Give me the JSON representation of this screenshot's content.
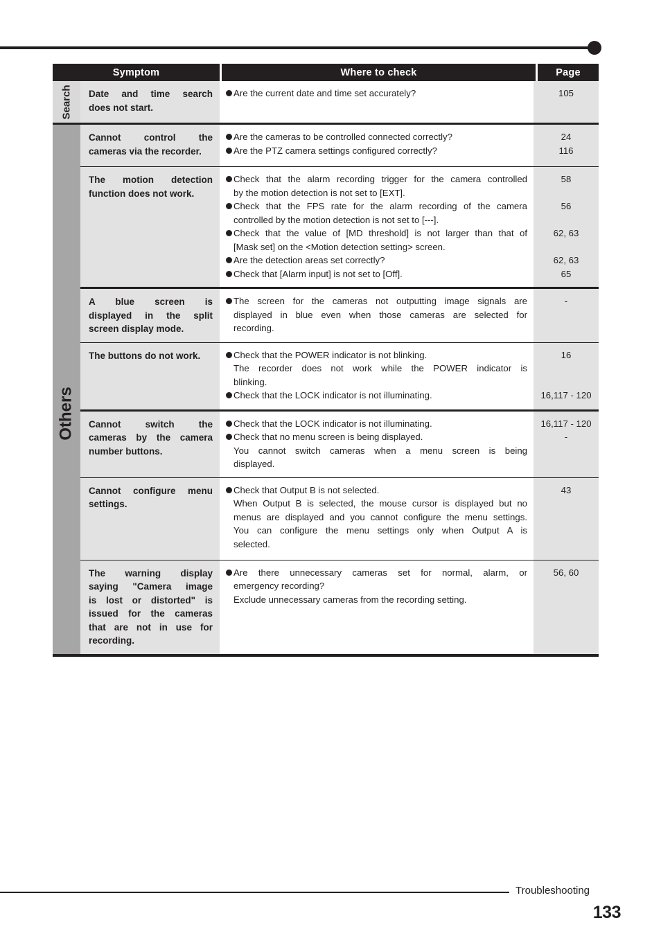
{
  "document": {
    "footer_section": "Troubleshooting",
    "page_number": "133"
  },
  "table": {
    "headers": {
      "symptom": "Symptom",
      "where_to_check": "Where to check",
      "page": "Page"
    },
    "categories": {
      "search": "Search",
      "others": "Others"
    },
    "rows": [
      {
        "symptom_lines": [
          "Date and time search",
          "does not start."
        ],
        "checks": [
          {
            "bullet": true,
            "lines": [
              "Are the current date and time set accurately?"
            ],
            "page": "105"
          }
        ]
      },
      {
        "symptom_lines": [
          "Cannot control the",
          "cameras via the recorder."
        ],
        "checks": [
          {
            "bullet": true,
            "lines": [
              "Are the cameras to be controlled connected correctly?"
            ],
            "page": "24"
          },
          {
            "bullet": true,
            "lines": [
              "Are the PTZ camera settings configured correctly?"
            ],
            "page": "116"
          }
        ]
      },
      {
        "symptom_lines": [
          "The motion detection",
          "function does not work."
        ],
        "checks": [
          {
            "bullet": true,
            "lines": [
              "Check that the alarm recording trigger for the camera controlled",
              "by the motion detection is not set to [EXT]."
            ],
            "page": "58"
          },
          {
            "bullet": true,
            "lines": [
              "Check that the FPS rate for the alarm recording of the camera",
              "controlled by the motion detection is not set to [---]."
            ],
            "page": "56"
          },
          {
            "bullet": true,
            "lines": [
              "Check that the value of [MD threshold] is not larger than that of",
              "[Mask set] on the <Motion detection setting> screen."
            ],
            "page": "62, 63"
          },
          {
            "bullet": true,
            "lines": [
              "Are the detection areas set correctly?"
            ],
            "page": "62, 63"
          },
          {
            "bullet": true,
            "lines": [
              "Check that [Alarm input] is not set to [Off]."
            ],
            "page": "65"
          }
        ]
      },
      {
        "symptom_lines": [
          "A blue screen is",
          "displayed in the split",
          "screen display mode."
        ],
        "checks": [
          {
            "bullet": true,
            "lines": [
              "The screen for the cameras not outputting image signals are",
              "displayed in blue even when those cameras are selected for",
              "recording."
            ],
            "page": "-"
          }
        ]
      },
      {
        "symptom_lines": [
          "The buttons do not work."
        ],
        "checks": [
          {
            "bullet": true,
            "lines": [
              "Check that the POWER indicator is not blinking."
            ],
            "page": "16"
          },
          {
            "bullet": false,
            "lines": [
              "The recorder does not work while the POWER indicator is",
              "blinking."
            ],
            "page": ""
          },
          {
            "bullet": true,
            "lines": [
              "Check that the LOCK indicator is not illuminating."
            ],
            "page": "16,117 - 120"
          }
        ]
      },
      {
        "symptom_lines": [
          "Cannot switch the",
          "cameras by the camera",
          "number buttons."
        ],
        "checks": [
          {
            "bullet": true,
            "lines": [
              "Check that the LOCK indicator is not illuminating."
            ],
            "page": "16,117 - 120"
          },
          {
            "bullet": true,
            "lines": [
              "Check that no menu screen is being displayed."
            ],
            "page": "-"
          },
          {
            "bullet": false,
            "lines": [
              "You cannot switch cameras when a menu screen is being",
              "displayed."
            ],
            "page": ""
          }
        ]
      },
      {
        "symptom_lines": [
          "Cannot configure menu",
          "settings."
        ],
        "checks": [
          {
            "bullet": true,
            "lines": [
              "Check that Output B is not selected."
            ],
            "page": "43"
          },
          {
            "bullet": false,
            "lines": [
              "When Output B is selected, the mouse cursor is displayed but no",
              "menus are displayed and you cannot configure the menu settings.",
              "You can configure the menu settings only when Output A is",
              "selected."
            ],
            "page": ""
          }
        ]
      },
      {
        "symptom_lines": [
          "The warning display",
          "saying \"Camera image",
          "is lost or distorted\" is",
          "issued for the cameras",
          "that are not in use for",
          "recording."
        ],
        "checks": [
          {
            "bullet": true,
            "lines": [
              "Are there unnecessary cameras set for normal, alarm, or",
              "emergency recording?"
            ],
            "page": "56, 60"
          },
          {
            "bullet": false,
            "lines": [
              "Exclude unnecessary cameras from the recording setting."
            ],
            "page": ""
          }
        ]
      }
    ]
  }
}
